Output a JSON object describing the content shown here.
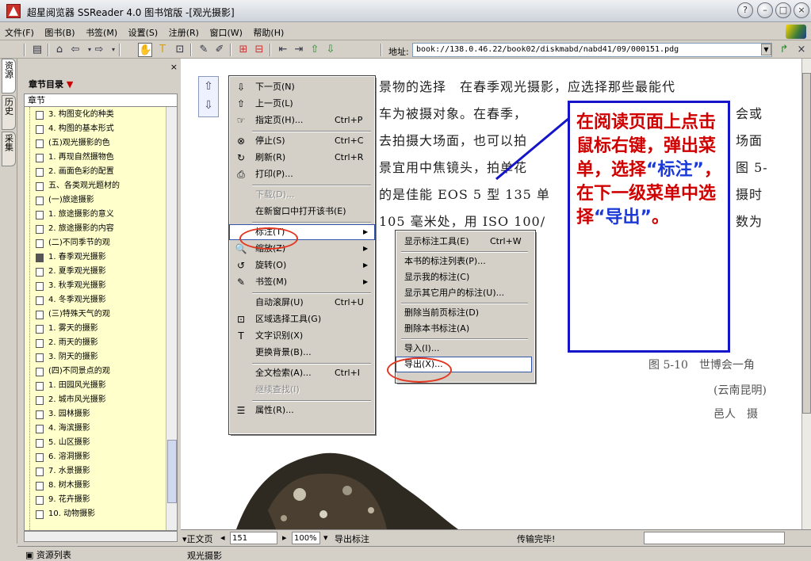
{
  "window": {
    "title": "超星阅览器 SSReader 4.0 图书馆版 -[观光摄影]",
    "controls": [
      "help",
      "minimize",
      "maximize",
      "close"
    ]
  },
  "menubar": {
    "items": [
      "文件(F)",
      "图书(B)",
      "书签(M)",
      "设置(S)",
      "注册(R)",
      "窗口(W)",
      "帮助(H)"
    ]
  },
  "toolbar": {
    "address_label": "地址:",
    "address_value": "book://138.0.46.22/book02/diskmabd/nabd41/09/000151.pdg"
  },
  "vertical_tabs": [
    "资源",
    "历史",
    "采集"
  ],
  "sidebar": {
    "close": "×",
    "title": "章节目录",
    "title_arrow": "▼",
    "column_header": "章节",
    "items": [
      "3. 构图变化的种类",
      "4. 构图的基本形式",
      "(五)观光摄影的色",
      "1. 再现自然摄物色",
      "2. 画面色彩的配置",
      "五、各类观光题材的",
      "(一)旅途摄影",
      "1. 旅途摄影的意义",
      "2. 旅途摄影的内容",
      "(二)不同季节的观",
      "1. 春季观光摄影",
      "2. 夏季观光摄影",
      "3. 秋季观光摄影",
      "4. 冬季观光摄影",
      "(三)特殊天气的观",
      "1. 雾天的摄影",
      "2. 雨天的摄影",
      "3. 阴天的摄影",
      "(四)不同景点的观",
      "1. 田园风光摄影",
      "2. 城市风光摄影",
      "3. 园林摄影",
      "4. 海滨摄影",
      "5. 山区摄影",
      "6. 溶洞摄影",
      "7. 水景摄影",
      "8. 树木摄影",
      "9. 花卉摄影",
      "10. 动物摄影"
    ],
    "selected_index": 10,
    "footer": "资源列表"
  },
  "document": {
    "lines": [
      "景物的选择　在春季观光摄影，应选择那些最能代",
      "车为被摄对象。在春季，",
      "去拍摄大场面，也可以拍",
      "景宜用中焦镜头，拍单花",
      "的是佳能 EOS 5 型 135 单",
      "105 毫米处，用 ISO 100/"
    ],
    "right_fragments": [
      "会或",
      "场面",
      "图 5-",
      "摄时",
      "数为"
    ],
    "caption": [
      "图 5-10　世博会一角",
      "(云南昆明)",
      "邑人　摄"
    ]
  },
  "context_menu": {
    "items": [
      {
        "icon": "arrow-down-icon",
        "label": "下一页(N)",
        "shortcut": ""
      },
      {
        "icon": "arrow-up-icon",
        "label": "上一页(L)",
        "shortcut": ""
      },
      {
        "icon": "goto-page-icon",
        "label": "指定页(H)...",
        "shortcut": "Ctrl+P"
      },
      {
        "icon": "stop-icon",
        "label": "停止(S)",
        "shortcut": "Ctrl+C"
      },
      {
        "icon": "refresh-icon",
        "label": "刷新(R)",
        "shortcut": "Ctrl+R"
      },
      {
        "icon": "printer-icon",
        "label": "打印(P)...",
        "shortcut": ""
      },
      {
        "icon": "",
        "label": "下载(D)...",
        "shortcut": "",
        "disabled": true
      },
      {
        "icon": "",
        "label": "在新窗口中打开该书(E)",
        "shortcut": ""
      },
      {
        "icon": "",
        "label": "标注(T)",
        "shortcut": "",
        "submenu": true,
        "highlighted": true
      },
      {
        "icon": "zoom-icon",
        "label": "缩放(Z)",
        "shortcut": "",
        "submenu": true
      },
      {
        "icon": "rotate-icon",
        "label": "旋转(O)",
        "shortcut": "",
        "submenu": true
      },
      {
        "icon": "bookmark-icon",
        "label": "书签(M)",
        "shortcut": "",
        "submenu": true
      },
      {
        "icon": "",
        "label": "自动滚屏(U)",
        "shortcut": "Ctrl+U"
      },
      {
        "icon": "region-select-icon",
        "label": "区域选择工具(G)",
        "shortcut": ""
      },
      {
        "icon": "ocr-text-icon",
        "label": "文字识别(X)",
        "shortcut": ""
      },
      {
        "icon": "",
        "label": "更换背景(B)...",
        "shortcut": ""
      },
      {
        "icon": "",
        "label": "全文检索(A)...",
        "shortcut": "Ctrl+I"
      },
      {
        "icon": "",
        "label": "继续查找(I)",
        "shortcut": "",
        "disabled": true
      },
      {
        "icon": "properties-icon",
        "label": "属性(R)...",
        "shortcut": ""
      }
    ]
  },
  "annotation_submenu": {
    "items": [
      {
        "label": "显示标注工具(E)",
        "shortcut": "Ctrl+W"
      },
      {
        "label": "本书的标注列表(P)...",
        "shortcut": ""
      },
      {
        "label": "显示我的标注(C)",
        "shortcut": ""
      },
      {
        "label": "显示其它用户的标注(U)...",
        "shortcut": ""
      },
      {
        "label": "删除当前页标注(D)",
        "shortcut": ""
      },
      {
        "label": "删除本书标注(A)",
        "shortcut": ""
      },
      {
        "label": "导入(I)...",
        "shortcut": ""
      },
      {
        "label": "导出(X)...",
        "shortcut": "",
        "highlighted": true
      }
    ]
  },
  "callout": {
    "part1": "在阅读页面上点击鼠标右键，弹出菜单，选择",
    "quote1": "“标注”",
    "part2": "，在下一级菜单中选择",
    "quote2": "“导出”",
    "part3": "。"
  },
  "statusbar": {
    "mode": "正文页",
    "page": "151",
    "zoom": "100%",
    "status": "导出标注",
    "transfer": "传输完毕!"
  },
  "doc_tab": "观光摄影",
  "colors": {
    "callout_border": "#1414c8",
    "callout_text": "#d00000",
    "callout_quote": "#1a39d8",
    "highlight_ellipse": "#e2361f",
    "tree_bg": "#ffffcc"
  }
}
